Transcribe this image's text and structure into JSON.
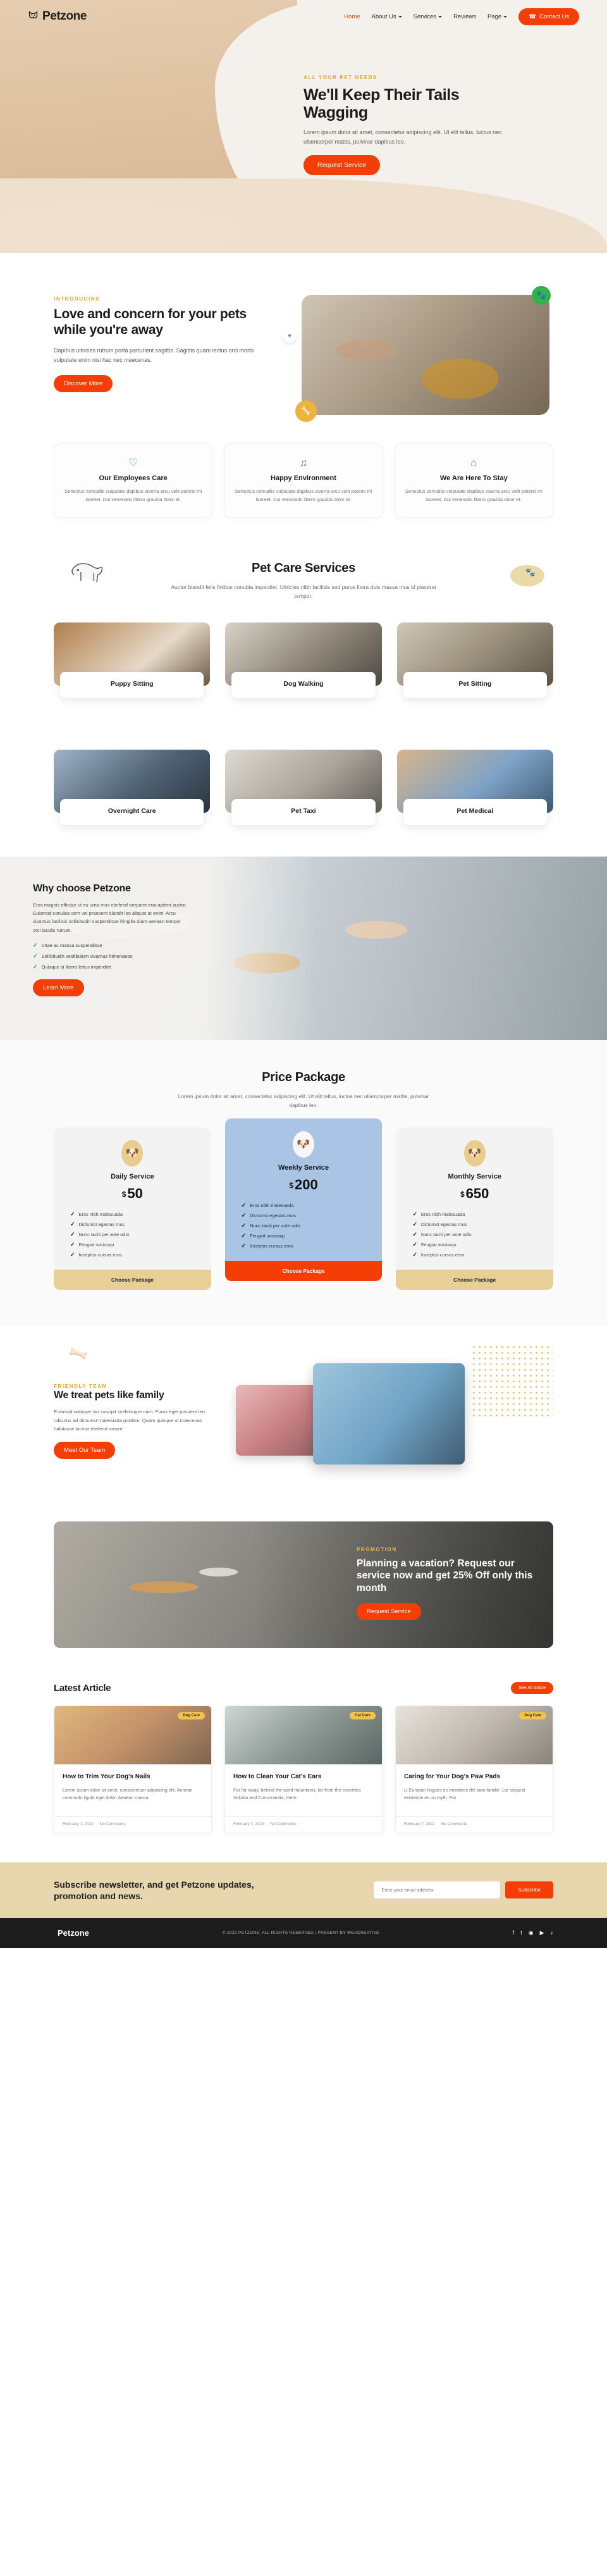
{
  "brand": {
    "name": "Petzone",
    "logo_icon": "dog-head-logo"
  },
  "nav": {
    "items": [
      {
        "label": "Home",
        "active": true,
        "has_dropdown": false
      },
      {
        "label": "About Us",
        "active": false,
        "has_dropdown": true
      },
      {
        "label": "Services",
        "active": false,
        "has_dropdown": true
      },
      {
        "label": "Reviews",
        "active": false,
        "has_dropdown": false
      },
      {
        "label": "Page",
        "active": false,
        "has_dropdown": true
      }
    ],
    "contact_button": "Contact Us",
    "contact_icon": "phone-icon"
  },
  "hero": {
    "eyebrow": "ALL YOUR PET NEEDS",
    "title": "We'll Keep Their Tails Wagging",
    "paragraph": "Lorem ipsum dolor sit amet, consectetur adipiscing elit. Ut elit tellus, luctus nec ullamcorper mattis, pulvinar dapibus leo.",
    "button": "Request Service"
  },
  "intro": {
    "eyebrow": "INTRODUCING",
    "title": "Love and concern for your pets while you're away",
    "paragraph": "Dapibus ultricies rutrum porta parturient sagittis. Sagittis quam lectus orci morbi vulputate enim nisi hac nec maecenas.",
    "button": "Discover More",
    "badge_green_icon": "paw-icon",
    "badge_yellow_icon": "bone-icon",
    "badge_white_icon": "pet-icon"
  },
  "features": [
    {
      "icon": "heart-icon",
      "color": "#35b14a",
      "title": "Our Employees Care",
      "text": "Senectus convallis vulputate dapibus viverra arcu velit potenti mi laoreet. Dui venenatis libero gravida dolor et."
    },
    {
      "icon": "music-note-icon",
      "color": "#35b14a",
      "title": "Happy Environment",
      "text": "Senectus convallis vulputate dapibus viverra arcu velit potenti mi laoreet. Dui venenatis libero gravida dolor et."
    },
    {
      "icon": "home-icon",
      "color": "#35b14a",
      "title": "We Are Here To Stay",
      "text": "Senectus convallis vulputate dapibus viverra arcu velit potenti mi laoreet. Dui venenatis libero gravida dolor et."
    }
  ],
  "services": {
    "title": "Pet Care Services",
    "subtitle": "Auctor blandit felis finibus conubia imperdiet. Ultricies nibh facilisis sed purus litora duis massa mus id placerat tempor.",
    "deco_dog_icon": "dog-illustration",
    "deco_paw_icon": "paw-print-icon",
    "cards": [
      {
        "label": "Puppy Sitting",
        "image": "puppy-in-bowl-photo"
      },
      {
        "label": "Dog Walking",
        "image": "dog-walking-photo"
      },
      {
        "label": "Pet Sitting",
        "image": "cat-sitting-photo"
      },
      {
        "label": "Overnight Care",
        "image": "dog-sleeping-photo"
      },
      {
        "label": "Pet Taxi",
        "image": "pet-carrier-photo"
      },
      {
        "label": "Pet Medical",
        "image": "vet-examining-dog-photo"
      }
    ]
  },
  "why": {
    "title": "Why choose Petzone",
    "paragraph": "Eros magnis efficitur ut eu urna mus eleifend torquent erat aptent auctor. Euismod conubia sem vel praesent blandit leo aliquet at enim. Arcu vivamus facilisis sollicitudin suspendisse fringilla diam aenean tempor orci iaculis rutrum.",
    "bullets": [
      "Vitae ac massa suspendisse",
      "Sollicitudin vestibulum vivamus himenaeos",
      "Quisque si libero letius imperdiet"
    ],
    "button": "Learn More",
    "check_icon": "check-icon"
  },
  "pricing": {
    "title": "Price Package",
    "subtitle": "Lorem ipsum dolor sit amet, consectetur adipiscing elit. Ut elit tellus, luctus nec ullamcorper mattis, pulvinar dapibus leo.",
    "plans": [
      {
        "name": "Daily Service",
        "currency": "$",
        "price": "50",
        "featured": false,
        "avatar_icon": "dog-face-icon",
        "features": [
          "Eros nibh malesuada",
          "Dictumst egestas mus",
          "Nunc taciti per ante odio",
          "Feugiat sociosqu",
          "Inceptos cursus eros"
        ],
        "button": "Choose Package"
      },
      {
        "name": "Weekly Service",
        "currency": "$",
        "price": "200",
        "featured": true,
        "avatar_icon": "dog-face-icon",
        "features": [
          "Eros nibh malesuada",
          "Dictumst egestas mus",
          "Nunc taciti per ante odio",
          "Feugiat sociosqu",
          "Inceptos cursus eros"
        ],
        "button": "Choose Package"
      },
      {
        "name": "Monthly Service",
        "currency": "$",
        "price": "650",
        "featured": false,
        "avatar_icon": "dog-face-icon",
        "features": [
          "Eros nibh malesuada",
          "Dictumst egestas mus",
          "Nunc taciti per ante odio",
          "Feugiat sociosqu",
          "Inceptos cursus eros"
        ],
        "button": "Choose Package"
      }
    ]
  },
  "family": {
    "eyebrow": "FRIENDLY TEAM",
    "title": "We treat pets like family",
    "paragraph": "Euismod natoque sto suscipit scelerisque nam. Purus eget posuere leo ridiculus ad dictumst malesuada porttitor. Quam quisque ut maecenas habitasse lacinia eleifend ornare.",
    "button": "Meet Our Team",
    "image_left": "woman-with-cat-photo",
    "image_right": "man-holding-cat-photo",
    "deco_bone_icon": "bone-icon"
  },
  "cta": {
    "eyebrow": "PROMOTION",
    "title": "Planning a vacation? Request our service now and get 25% Off only this month",
    "button": "Request Service",
    "image": "dog-with-leash-photo"
  },
  "articles": {
    "title": "Latest Article",
    "see_all": "See All Article",
    "items": [
      {
        "tag": "Dog Care",
        "title": "How to Trim Your Dog's Nails",
        "excerpt": "Lorem ipsum dolor sit amet, consectetuer adipiscing elit. Aenean commodo ligula eget dolor. Aenean massa.",
        "date": "February 7, 2022",
        "comments": "No Comments",
        "image": "trimming-dog-nails-photo"
      },
      {
        "tag": "Cat Care",
        "title": "How to Clean Your Cat's Ears",
        "excerpt": "Far far away, behind the word mountains, far from the countries Vokalia and Consonantia, there",
        "date": "February 7, 2022",
        "comments": "No Comments",
        "image": "cleaning-cat-ears-photo"
      },
      {
        "tag": "Dog Care",
        "title": "Caring for Your Dog's Paw Pads",
        "excerpt": "Li Europan lingues es membres del sam familie. Lor separat existentie es un myth. Por",
        "date": "February 7, 2022",
        "comments": "No Comments",
        "image": "dog-paw-pads-photo"
      }
    ]
  },
  "newsletter": {
    "title": "Subscribe newsletter, and get Petzone updates, promotion and news.",
    "placeholder": "Enter your email address",
    "button": "Subscribe"
  },
  "footer": {
    "brand": "Petzone",
    "copyright": "© 2022 PETZONE. ALL RIGHTS RESERVED | PRESENT BY WEACREATIVE",
    "social": [
      {
        "name": "facebook-icon",
        "glyph": "f"
      },
      {
        "name": "twitter-icon",
        "glyph": "t"
      },
      {
        "name": "instagram-icon",
        "glyph": "◉"
      },
      {
        "name": "youtube-icon",
        "glyph": "▶"
      },
      {
        "name": "tiktok-icon",
        "glyph": "♪"
      }
    ]
  },
  "colors": {
    "accent": "#f53d06",
    "yellow": "#e7a325",
    "green": "#35b14a",
    "cream": "#e8d6af",
    "blue": "#a9c4e4"
  }
}
